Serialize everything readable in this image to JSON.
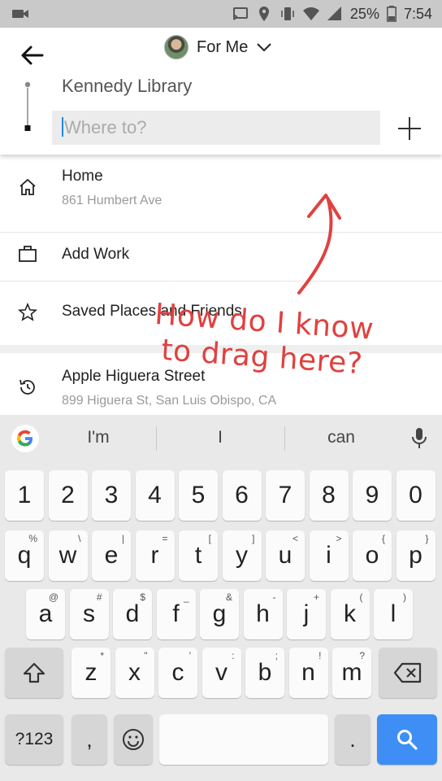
{
  "status_bar": {
    "battery": "25%",
    "time": "7:54",
    "icons": [
      "cast-icon",
      "location-icon",
      "vibrate-icon",
      "wifi-icon",
      "signal-icon",
      "battery-icon"
    ]
  },
  "header": {
    "profile_label": "For Me",
    "pickup": "Kennedy Library",
    "destination_placeholder": "Where to?"
  },
  "list": {
    "items": [
      {
        "icon": "home-icon",
        "title": "Home",
        "subtitle": "861 Humbert Ave"
      },
      {
        "icon": "briefcase-icon",
        "title": "Add Work",
        "subtitle": ""
      },
      {
        "icon": "star-icon",
        "title": "Saved Places and Friends",
        "subtitle": ""
      },
      {
        "icon": "history-icon",
        "title": "Apple Higuera Street",
        "subtitle": "899 Higuera St, San Luis Obispo, CA"
      }
    ]
  },
  "annotation": {
    "line1": "How do I know",
    "line2": "to drag here?",
    "color": "#e0413f"
  },
  "keyboard": {
    "suggestions": [
      "I'm",
      "I",
      "can"
    ],
    "row_numbers": [
      "1",
      "2",
      "3",
      "4",
      "5",
      "6",
      "7",
      "8",
      "9",
      "0"
    ],
    "row_top": [
      {
        "k": "q",
        "h": "%"
      },
      {
        "k": "w",
        "h": "\\"
      },
      {
        "k": "e",
        "h": "|"
      },
      {
        "k": "r",
        "h": "="
      },
      {
        "k": "t",
        "h": "["
      },
      {
        "k": "y",
        "h": "]"
      },
      {
        "k": "u",
        "h": "<"
      },
      {
        "k": "i",
        "h": ">"
      },
      {
        "k": "o",
        "h": "{"
      },
      {
        "k": "p",
        "h": "}"
      }
    ],
    "row_mid": [
      {
        "k": "a",
        "h": "@"
      },
      {
        "k": "s",
        "h": "#"
      },
      {
        "k": "d",
        "h": "$"
      },
      {
        "k": "f",
        "h": "_"
      },
      {
        "k": "g",
        "h": "&"
      },
      {
        "k": "h",
        "h": "-"
      },
      {
        "k": "j",
        "h": "+"
      },
      {
        "k": "k",
        "h": "("
      },
      {
        "k": "l",
        "h": ")"
      }
    ],
    "row_bot": [
      {
        "k": "z",
        "h": "*"
      },
      {
        "k": "x",
        "h": "\""
      },
      {
        "k": "c",
        "h": "'"
      },
      {
        "k": "v",
        "h": ":"
      },
      {
        "k": "b",
        "h": ";"
      },
      {
        "k": "n",
        "h": "!"
      },
      {
        "k": "m",
        "h": "?"
      }
    ],
    "symbols_label": "?123",
    "comma": ",",
    "period": ".",
    "accent_color": "#3f8ef6"
  }
}
